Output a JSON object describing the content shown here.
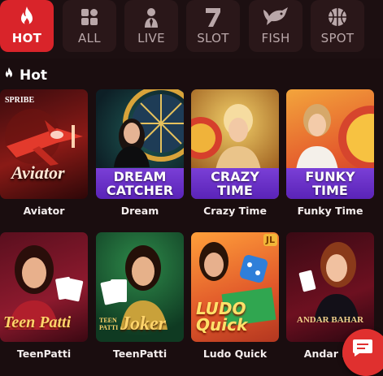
{
  "tabs": [
    {
      "label": "HOT",
      "icon": "flame-icon",
      "active": true
    },
    {
      "label": "ALL",
      "icon": "grid-icon",
      "active": false
    },
    {
      "label": "LIVE",
      "icon": "dealer-icon",
      "active": false
    },
    {
      "label": "SLOT",
      "icon": "seven-icon",
      "active": false
    },
    {
      "label": "FISH",
      "icon": "fish-icon",
      "active": false
    },
    {
      "label": "SPOT",
      "icon": "ball-icon",
      "active": false
    }
  ],
  "section": {
    "title": "Hot",
    "icon": "flame-icon"
  },
  "games": [
    {
      "name": "Aviator",
      "art_text": "Aviator",
      "brand": "SPRIBE"
    },
    {
      "name": "Dream",
      "art_text": "DREAM CATCHER"
    },
    {
      "name": "Crazy Time",
      "art_text": "CRAZY TIME"
    },
    {
      "name": "Funky Time",
      "art_text": "FUNKY TIME"
    },
    {
      "name": "TeenPatti",
      "art_text": "Teen Patti"
    },
    {
      "name": "TeenPatti",
      "art_text": "Joker",
      "art_sub": "TEEN PATTI"
    },
    {
      "name": "Ludo Quick",
      "art_text": "LUDO Quick",
      "badge": "JL"
    },
    {
      "name": "Andar Ba",
      "art_text": "ANDAR BAHAR"
    }
  ],
  "colors": {
    "accent": "#d9242a",
    "background": "#1a0d0f",
    "tab_bg": "#2a1719",
    "chat": "#e0302f"
  },
  "chat_button": {
    "icon": "chat-icon"
  }
}
